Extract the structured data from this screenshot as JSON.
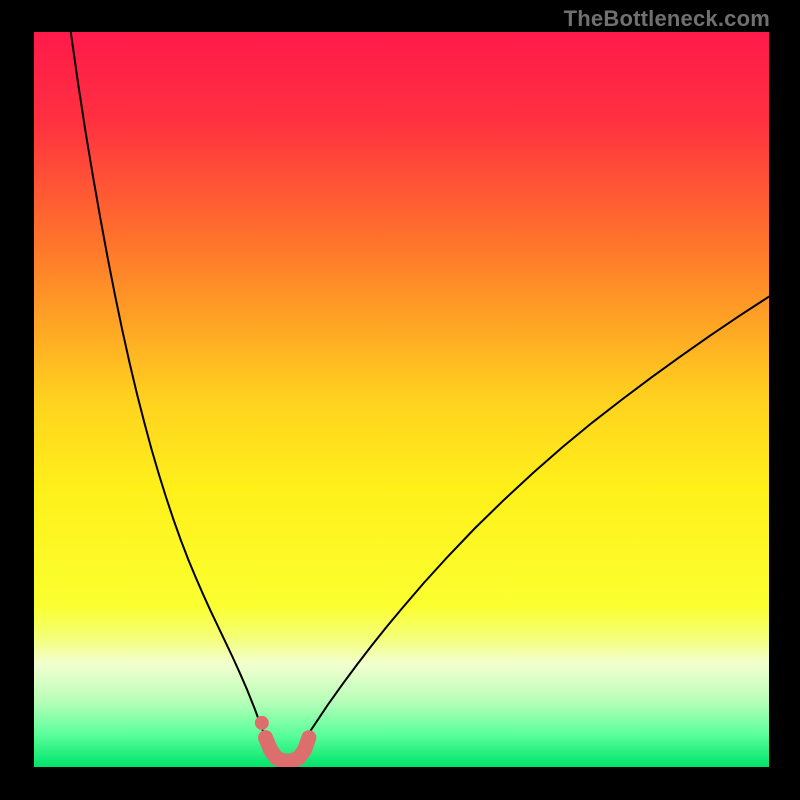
{
  "watermark": "TheBottleneck.com",
  "chart_data": {
    "type": "line",
    "title": "",
    "xlabel": "",
    "ylabel": "",
    "xlim": [
      0,
      100
    ],
    "ylim": [
      0,
      100
    ],
    "grid": false,
    "legend": false,
    "background_gradient_stops": [
      {
        "offset": 0.0,
        "color": "#ff1a4b"
      },
      {
        "offset": 0.12,
        "color": "#ff3040"
      },
      {
        "offset": 0.3,
        "color": "#ff7a2a"
      },
      {
        "offset": 0.5,
        "color": "#ffd21f"
      },
      {
        "offset": 0.62,
        "color": "#fff01a"
      },
      {
        "offset": 0.78,
        "color": "#fbff30"
      },
      {
        "offset": 0.82,
        "color": "#f5ff70"
      },
      {
        "offset": 0.86,
        "color": "#f2ffd0"
      },
      {
        "offset": 0.91,
        "color": "#b8ffb8"
      },
      {
        "offset": 0.955,
        "color": "#5cff9c"
      },
      {
        "offset": 1.0,
        "color": "#00e36b"
      }
    ],
    "series": [
      {
        "name": "left-curve",
        "color": "#000000",
        "stroke_width": 2,
        "x": [
          5,
          6,
          7,
          8,
          9,
          10,
          11,
          12,
          13,
          14,
          15,
          16,
          17,
          18,
          19,
          20,
          21,
          22,
          23,
          24,
          25,
          26,
          27,
          28,
          29,
          30,
          31,
          31.5
        ],
        "y": [
          100,
          93,
          86.5,
          80.5,
          74.8,
          69.4,
          64.3,
          59.5,
          55,
          50.8,
          46.9,
          43.2,
          39.8,
          36.6,
          33.6,
          30.8,
          28.2,
          25.8,
          23.5,
          21.3,
          19.2,
          17.1,
          15,
          12.8,
          10.5,
          8,
          5.3,
          4
        ]
      },
      {
        "name": "right-curve",
        "color": "#000000",
        "stroke_width": 2,
        "x": [
          37,
          38,
          40,
          42,
          44,
          46,
          48,
          50,
          53,
          56,
          60,
          64,
          68,
          72,
          76,
          80,
          84,
          88,
          92,
          96,
          100
        ],
        "y": [
          4,
          5.5,
          8.5,
          11.3,
          14,
          16.6,
          19.1,
          21.5,
          25,
          28.3,
          32.5,
          36.4,
          40.1,
          43.6,
          46.9,
          50,
          53,
          55.9,
          58.7,
          61.4,
          64
        ]
      },
      {
        "name": "bottleneck-marker",
        "type": "marker-path",
        "color": "#dd6e6e",
        "stroke_width": 15,
        "dots": [
          {
            "x": 31.0,
            "y": 6.0,
            "r": 7
          }
        ],
        "path_x": [
          31.5,
          32.2,
          33.0,
          34.0,
          35.0,
          36.0,
          36.8,
          37.4
        ],
        "path_y": [
          4.0,
          2.3,
          1.2,
          0.8,
          0.8,
          1.2,
          2.3,
          4.0
        ]
      }
    ]
  }
}
